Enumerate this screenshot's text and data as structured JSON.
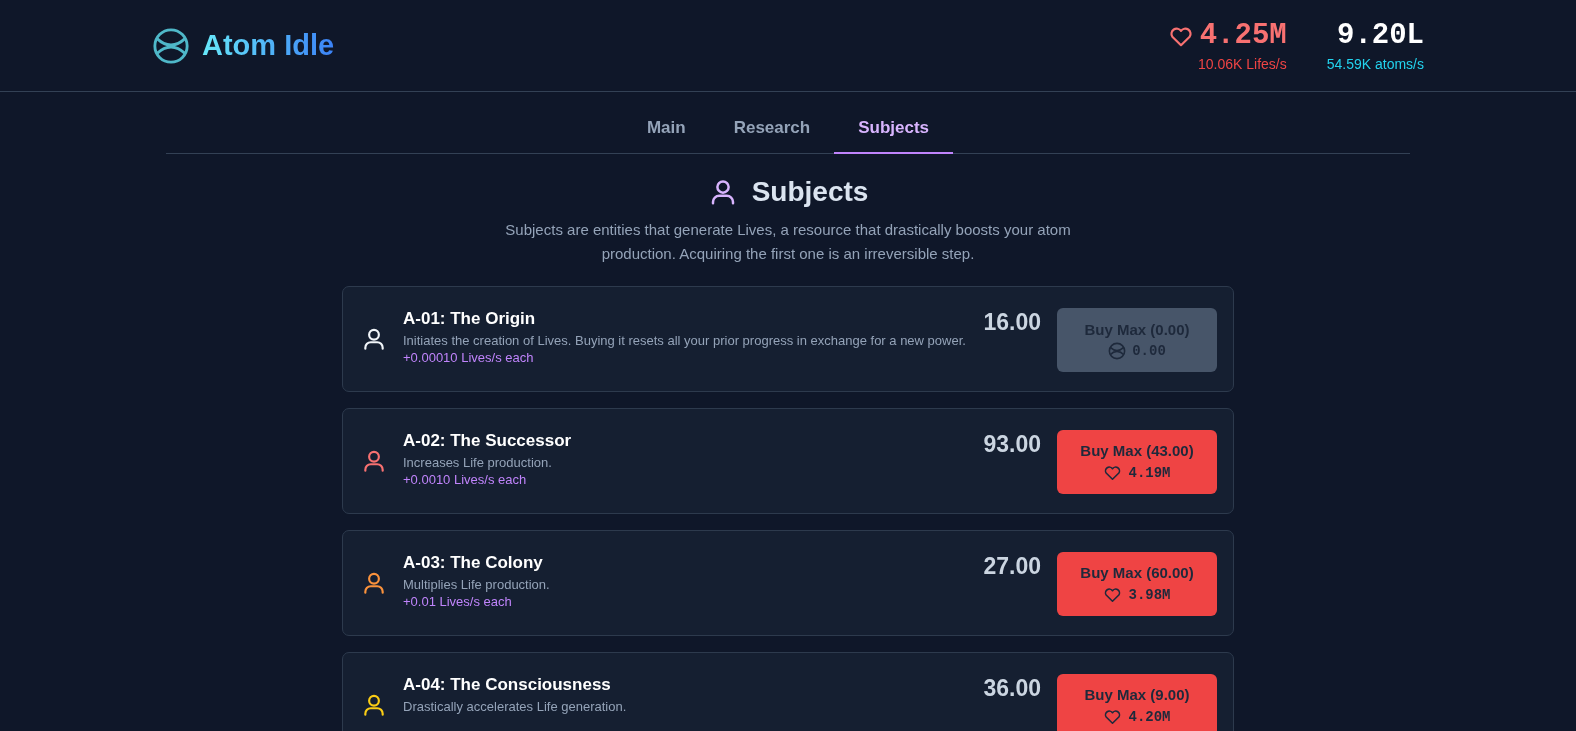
{
  "header": {
    "title": "Atom Idle",
    "lives": {
      "value": "4.25M",
      "rate": "10.06K Lifes/s"
    },
    "atoms": {
      "value": "9.20L",
      "rate": "54.59K atoms/s"
    }
  },
  "tabs": [
    {
      "label": "Main",
      "selected": false
    },
    {
      "label": "Research",
      "selected": false
    },
    {
      "label": "Subjects",
      "selected": true
    }
  ],
  "section": {
    "title": "Subjects",
    "description": "Subjects are entities that generate Lives, a resource that drastically boosts your atom production. Acquiring the first one is an irreversible step."
  },
  "subjects": [
    {
      "name": "A-01: The Origin",
      "description": "Initiates the creation of Lives. Buying it resets all your prior progress in exchange for a new power.",
      "production": "+0.00010 Lives/s each",
      "owned": "16.00",
      "color": "#f1f5f9",
      "button": {
        "label": "Buy Max (0.00)",
        "cost": "0.00",
        "kind": "atoms",
        "disabled": true
      }
    },
    {
      "name": "A-02: The Successor",
      "description": "Increases Life production.",
      "production": "+0.0010 Lives/s each",
      "owned": "93.00",
      "color": "#f87171",
      "button": {
        "label": "Buy Max (43.00)",
        "cost": "4.19M",
        "kind": "lives",
        "disabled": false
      }
    },
    {
      "name": "A-03: The Colony",
      "description": "Multiplies Life production.",
      "production": "+0.01 Lives/s each",
      "owned": "27.00",
      "color": "#fb923c",
      "button": {
        "label": "Buy Max (60.00)",
        "cost": "3.98M",
        "kind": "lives",
        "disabled": false
      }
    },
    {
      "name": "A-04: The Consciousness",
      "description": "Drastically accelerates Life generation.",
      "owned": "36.00",
      "color": "#facc15",
      "button": {
        "label": "Buy Max (9.00)",
        "cost": "4.20M",
        "kind": "lives",
        "disabled": false
      }
    }
  ]
}
